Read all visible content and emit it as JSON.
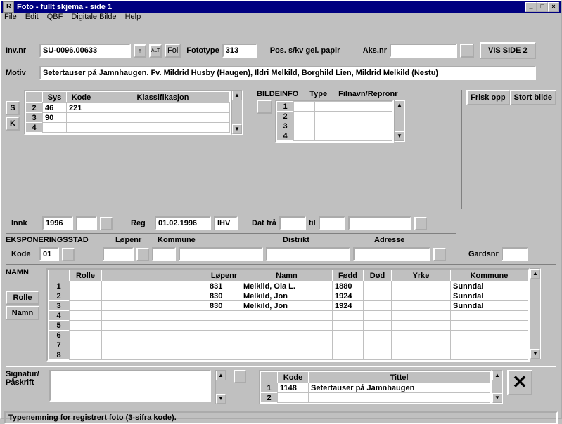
{
  "window": {
    "title": "Foto - fullt skjema - side 1"
  },
  "menu": {
    "file": "File",
    "edit": "Edit",
    "qbf": "QBF",
    "digitale": "Digitale Bilde",
    "help": "Help"
  },
  "row1": {
    "invnr_label": "Inv.nr",
    "invnr": "SU-0096.00633",
    "alt_btn": "ALT",
    "fol_btn": "Fol",
    "fototype_label": "Fototype",
    "fototype": "313",
    "pos_label": "Pos. s/kv gel. papir",
    "aksnr_label": "Aks.nr",
    "vis_btn": "VIS SIDE 2"
  },
  "motiv": {
    "label": "Motiv",
    "text": "Setertauser på Jamnhaugen. Fv. Mildrid Husby (Haugen), Ildri Melkild, Borghild Lien, Mildrid Melkild (Nestu)"
  },
  "classgrid": {
    "headers": {
      "sys": "Sys",
      "kode": "Kode",
      "klass": "Klassifikasjon"
    },
    "rows": [
      {
        "n": "2",
        "sys": "46",
        "kode": "221"
      },
      {
        "n": "3",
        "sys": "90",
        "kode": ""
      },
      {
        "n": "4",
        "sys": "",
        "kode": ""
      }
    ],
    "s_btn": "S",
    "k_btn": "K"
  },
  "bildeinfo": {
    "label": "BILDEINFO",
    "headers": {
      "type": "Type",
      "filnavn": "Filnavn/Repronr"
    },
    "rows": [
      "1",
      "2",
      "3",
      "4"
    ]
  },
  "right_buttons": {
    "frisk": "Frisk opp",
    "stort": "Stort bilde"
  },
  "dates": {
    "innk_label": "Innk",
    "innk": "1996",
    "reg_label": "Reg",
    "reg": "01.02.1996",
    "ihv": "IHV",
    "datfra_label": "Dat frå",
    "til_label": "til"
  },
  "eksponering": {
    "heading": "EKSPONERINGSSTAD",
    "lopenr": "Løpenr",
    "kommune": "Kommune",
    "distrikt": "Distrikt",
    "adresse": "Adresse",
    "kode_label": "Kode",
    "kode": "01",
    "gard_label": "Gardsnr"
  },
  "namn": {
    "heading": "NAMN",
    "headers": {
      "rolle": "Rolle",
      "lopenr": "Løpenr",
      "namn": "Namn",
      "fodd": "Fødd",
      "dod": "Død",
      "yrke": "Yrke",
      "kommune": "Kommune"
    },
    "rolle_btn": "Rolle",
    "namn_btn": "Namn",
    "rows": [
      {
        "n": "1",
        "lopenr": "831",
        "namn": "Melkild, Ola L.",
        "fodd": "1880",
        "kommune": "Sunndal"
      },
      {
        "n": "2",
        "lopenr": "830",
        "namn": "Melkild, Jon",
        "fodd": "1924",
        "kommune": "Sunndal"
      },
      {
        "n": "3",
        "lopenr": "830",
        "namn": "Melkild, Jon",
        "fodd": "1924",
        "kommune": "Sunndal"
      },
      {
        "n": "4"
      },
      {
        "n": "5"
      },
      {
        "n": "6"
      },
      {
        "n": "7"
      },
      {
        "n": "8"
      }
    ]
  },
  "bottom": {
    "sig_label1": "Signatur/",
    "sig_label2": "Påskrift",
    "tittel_headers": {
      "kode": "Kode",
      "tittel": "Tittel"
    },
    "tittel_rows": [
      {
        "n": "1",
        "kode": "1148",
        "tittel": "Setertauser på Jamnhaugen"
      },
      {
        "n": "2"
      }
    ]
  },
  "status": "Typenemning for registrert foto (3-sifra kode)."
}
